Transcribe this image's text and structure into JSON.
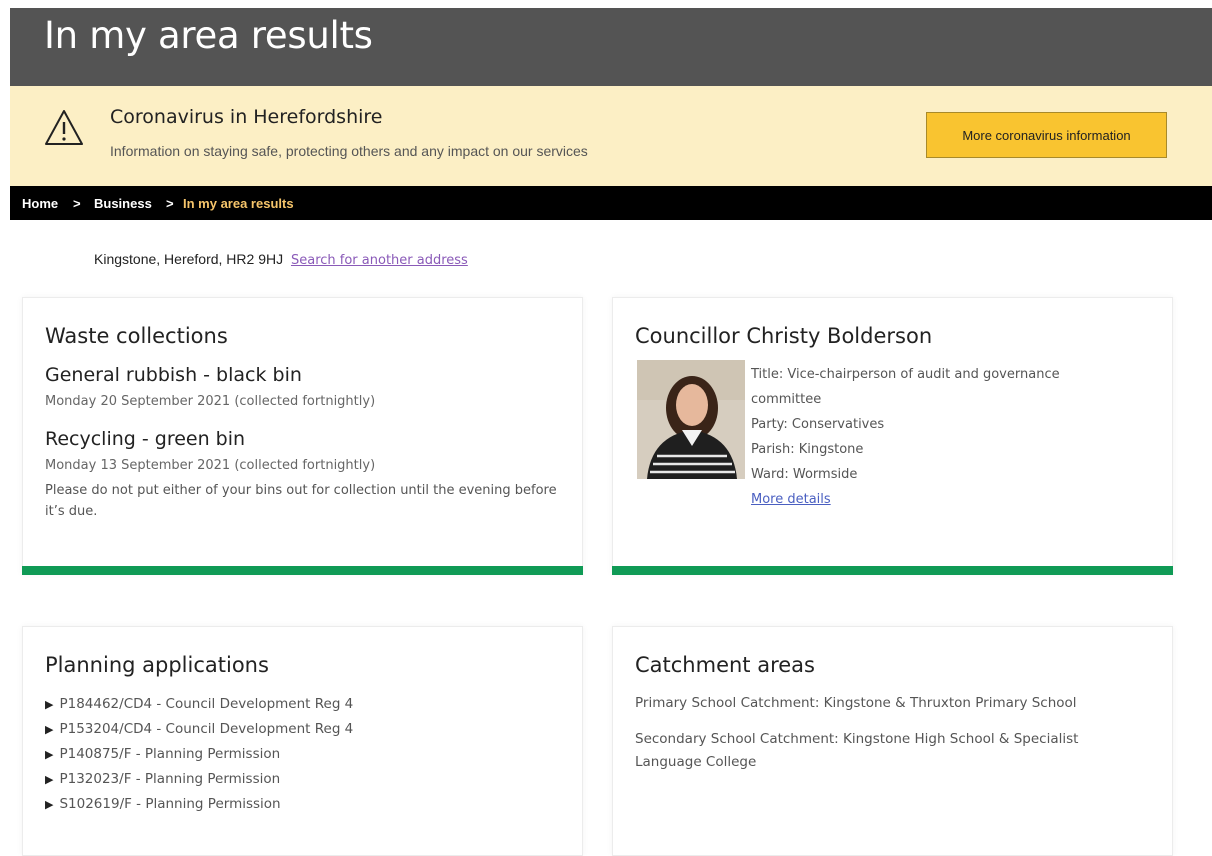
{
  "header": {
    "title": "In my area results"
  },
  "alert": {
    "icon": "warning-triangle-icon",
    "title": "Coronavirus in Herefordshire",
    "text": "Information on staying safe, protecting others and any impact on our services",
    "button_label": "More coronavirus information",
    "button_color": "#f9c430"
  },
  "breadcrumb": {
    "items": [
      "Home",
      "Business",
      "In my area results"
    ],
    "separator": ">"
  },
  "address": {
    "text": "Kingstone, Hereford, HR2 9HJ",
    "link": "Search for another address"
  },
  "waste": {
    "title": "Waste collections",
    "items": [
      {
        "name": "General rubbish - black bin",
        "date": "Monday 20 September 2021 (collected fortnightly)"
      },
      {
        "name": "Recycling - green bin",
        "date": "Monday 13 September 2021 (collected fortnightly)"
      }
    ],
    "note": "Please do not put either of your bins out for collection until the evening before it’s due."
  },
  "councillor": {
    "title": "Councillor Christy Bolderson",
    "role": "Title: Vice-chairperson of audit and governance committee",
    "party": "Party: Conservatives",
    "parish": "Parish: Kingstone",
    "ward": "Ward: Wormside",
    "link": "More details"
  },
  "planning": {
    "title": "Planning applications",
    "items": [
      "P184462/CD4 - Council Development Reg 4",
      "P153204/CD4 - Council Development Reg 4",
      "P140875/F - Planning Permission",
      "P132023/F - Planning Permission",
      "S102619/F - Planning Permission"
    ]
  },
  "catchment": {
    "title": "Catchment areas",
    "primary": "Primary School Catchment: Kingstone & Thruxton Primary School",
    "secondary": "Secondary School Catchment: Kingstone High School & Specialist Language College"
  },
  "colors": {
    "accent_green": "#0f9a55",
    "header_grey": "#545454",
    "alert_bg": "#fcefc5"
  }
}
